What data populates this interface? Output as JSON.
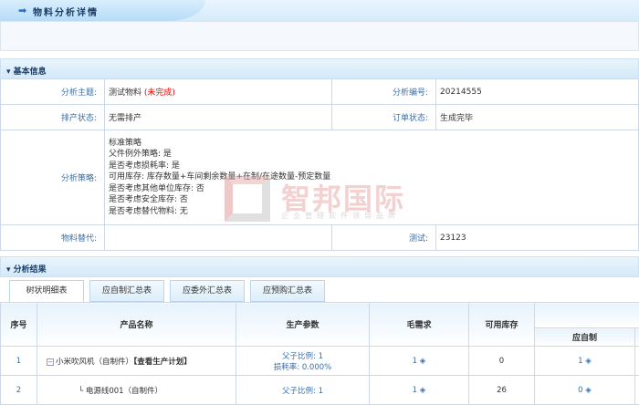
{
  "header": {
    "title": "物料分析详情",
    "icon": "arrow-right-icon"
  },
  "basic": {
    "title": "基本信息",
    "subject_label": "分析主题:",
    "subject_value": "测试物料",
    "subject_status": "(未完成)",
    "code_label": "分析编号:",
    "code_value": "20214555",
    "schedule_label": "排产状态:",
    "schedule_value": "无需排产",
    "order_label": "订单状态:",
    "order_value": "生成完毕",
    "strategy_label": "分析策略:",
    "strategy_lines": [
      "标准策略",
      "父件例外策略: 是",
      "是否考虑损耗率: 是",
      "可用库存: 库存数量+车间剩余数量+在制/在途数量-预定数量",
      "是否考虑其他单位库存: 否",
      "是否考虑安全库存: 否",
      "是否考虑替代物料: 无"
    ],
    "substitute_label": "物料替代:",
    "substitute_value": "",
    "test_label": "测试:",
    "test_value": "23123"
  },
  "watermark": {
    "big": "智邦国际",
    "small": "企业管理软件领导品牌"
  },
  "results": {
    "title": "分析结果",
    "tabs": [
      "树状明细表",
      "应自制汇总表",
      "应委外汇总表",
      "应预购汇总表"
    ],
    "columns": [
      "序号",
      "产品名称",
      "生产参数",
      "毛需求",
      "可用库存",
      "应自制"
    ],
    "rows": [
      {
        "no": "1",
        "name": "小米吹风机（自制件）",
        "link": "【查看生产计划】",
        "param1": "父子比例: 1",
        "param2": "损耗率: 0.000%",
        "gross": "1",
        "available": "0",
        "self_make": "1"
      },
      {
        "no": "2",
        "name": "电源线001（自制件）",
        "link": "",
        "param1": "父子比例: 1",
        "param2": "",
        "gross": "1",
        "available": "26",
        "self_make": "0"
      }
    ]
  }
}
